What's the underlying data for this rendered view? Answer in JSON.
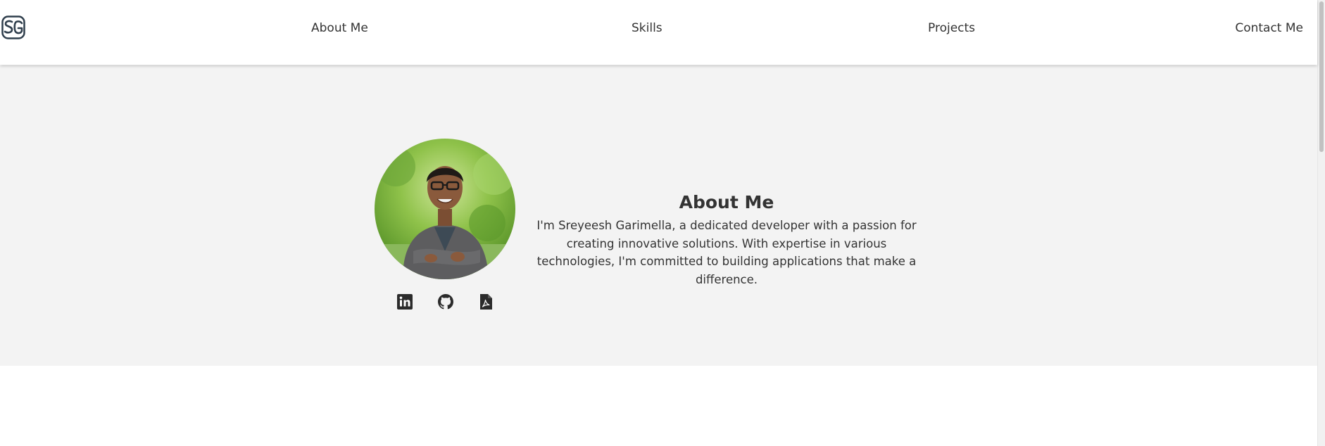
{
  "header": {
    "logo_text": "SG",
    "nav": [
      {
        "label": "About Me"
      },
      {
        "label": "Skills"
      },
      {
        "label": "Projects"
      },
      {
        "label": "Contact Me"
      }
    ]
  },
  "about": {
    "title": "About Me",
    "description": "I'm Sreyeesh Garimella, a dedicated developer with a passion for creating innovative solutions. With expertise in various technologies, I'm committed to building applications that make a difference.",
    "social": [
      {
        "icon": "linkedin-icon"
      },
      {
        "icon": "github-icon"
      },
      {
        "icon": "pdf-resume-icon"
      }
    ]
  },
  "colors": {
    "text": "#333333",
    "section_bg": "#f3f3f3",
    "logo": "#2f3e4c"
  }
}
